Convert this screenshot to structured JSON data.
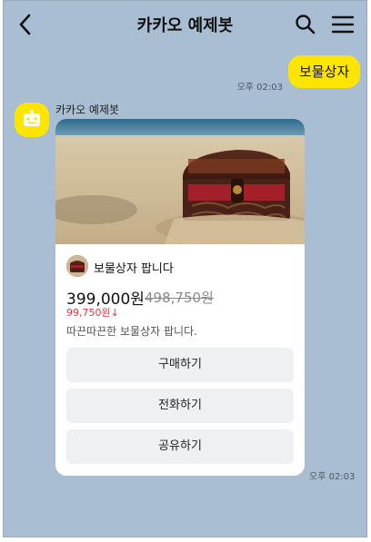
{
  "header": {
    "title": "카카오 예제봇"
  },
  "icons": {
    "back": "chevron-left-icon",
    "search": "search-icon",
    "menu": "hamburger-menu-icon",
    "avatar": "bot-icon"
  },
  "messages": {
    "outgoing": {
      "text": "보물상자",
      "time": "오후 02:03"
    },
    "incoming": {
      "sender": "카카오 예제봇",
      "time": "오후 02:03",
      "card": {
        "product_name": "보물상자 팝니다",
        "price": "399,000원",
        "original_price": "498,750원",
        "discount": "99,750원↓",
        "description": "따끈따끈한 보물상자 팝니다.",
        "buttons": [
          "구매하기",
          "전화하기",
          "공유하기"
        ]
      }
    }
  },
  "colors": {
    "background": "#a9bed3",
    "bubble_yellow": "#fee500",
    "discount_red": "#e4393c"
  }
}
